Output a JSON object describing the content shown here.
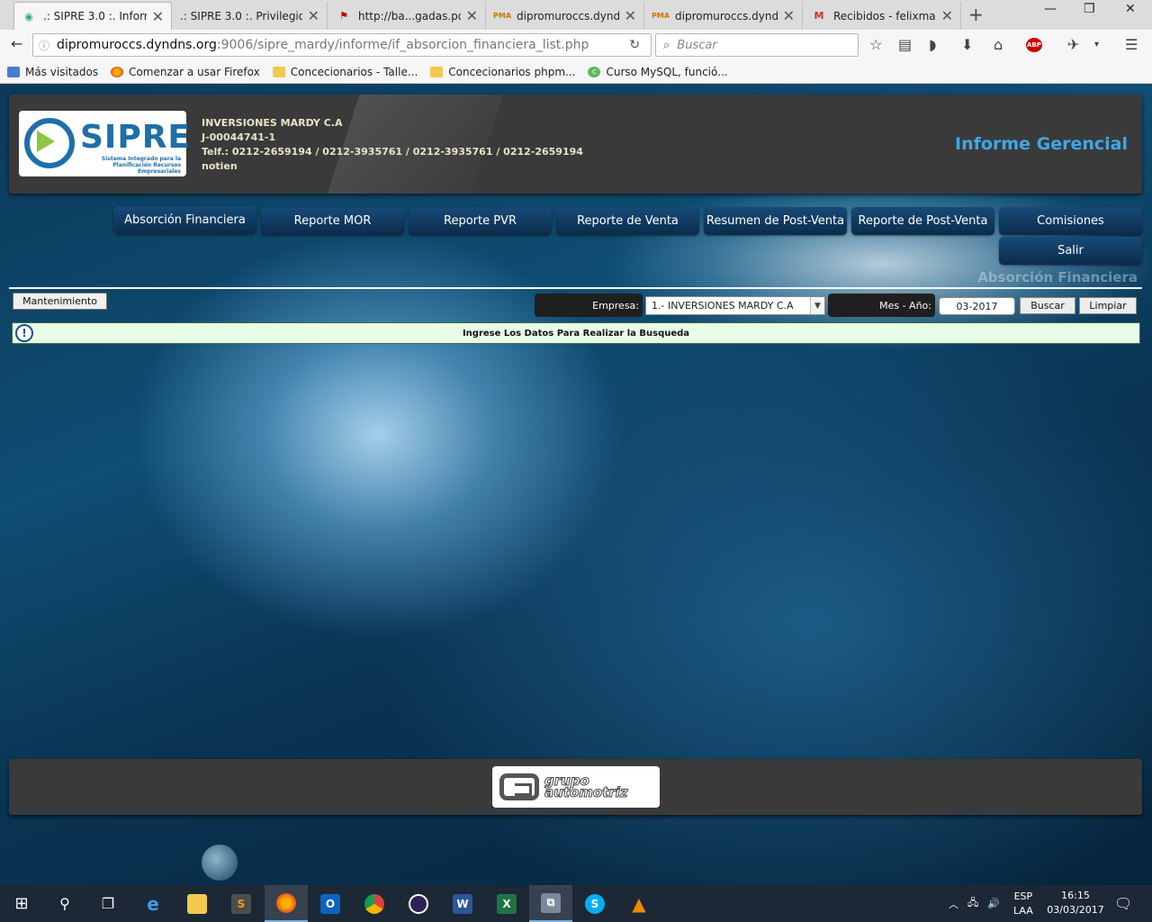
{
  "browser": {
    "tabs": [
      {
        "label": ".: SIPRE 3.0 :. Inform...",
        "icon": "globe-icon",
        "active": true
      },
      {
        "label": ".: SIPRE 3.0 :. Privilegios ...",
        "icon": "",
        "active": false
      },
      {
        "label": "http://ba...gadas.pdf",
        "icon": "pdf-icon",
        "active": false
      },
      {
        "label": "dipromuroccs.dynd...",
        "icon": "pma-icon",
        "active": false
      },
      {
        "label": "dipromuroccs.dynd...",
        "icon": "pma-icon",
        "active": false
      },
      {
        "label": "Recibidos - felixmar...",
        "icon": "gmail-icon",
        "active": false
      }
    ],
    "url_domain": "dipromuroccs.dyndns.org",
    "url_path": ":9006/sipre_mardy/informe/if_absorcion_financiera_list.php",
    "search_placeholder": "Buscar",
    "bookmarks": [
      {
        "label": "Más visitados",
        "icon": "bookmark-star-icon"
      },
      {
        "label": "Comenzar a usar Firefox",
        "icon": "firefox-icon"
      },
      {
        "label": "Concecionarios - Talle...",
        "icon": "folder-icon"
      },
      {
        "label": "Concecionarios phpm...",
        "icon": "folder-icon"
      },
      {
        "label": "Curso MySQL, funció...",
        "icon": "course-icon"
      }
    ]
  },
  "header": {
    "logo_text": "SIPRE",
    "logo_subtitle": "Sistema Integrado para la Planificación Recursos Empresariales",
    "company_name": "INVERSIONES MARDY C.A",
    "rif": "J-00044741-1",
    "phones": "Telf.: 0212-2659194 / 0212-3935761 / 0212-3935761 / 0212-2659194",
    "user": "notien",
    "report_title": "Informe Gerencial"
  },
  "menu": {
    "items": [
      "Absorción Financiera",
      "Reporte MOR",
      "Reporte PVR",
      "Reporte de Venta",
      "Resumen de Post-Venta",
      "Reporte de Post-Venta",
      "Comisiones"
    ],
    "logout": "Salir"
  },
  "section_title": "Absorción Financiera",
  "toolbar": {
    "mantenimiento": "Mantenimiento",
    "empresa_label": "Empresa:",
    "empresa_value": "1.- INVERSIONES MARDY C.A",
    "mes_label": "Mes - Año:",
    "mes_value": "03-2017",
    "buscar": "Buscar",
    "limpiar": "Limpiar"
  },
  "info_message": "Ingrese Los Datos Para Realizar la Busqueda",
  "footer": {
    "logo_line1": "grupo",
    "logo_line2": "automotriz"
  },
  "taskbar": {
    "lang_line1": "ESP",
    "lang_line2": "LAA",
    "time": "16:15",
    "date": "03/03/2017"
  },
  "colors": {
    "accent_title": "#3ea7e6",
    "menu_button": "#0b2c4a",
    "info_bg": "#e8fde8"
  }
}
